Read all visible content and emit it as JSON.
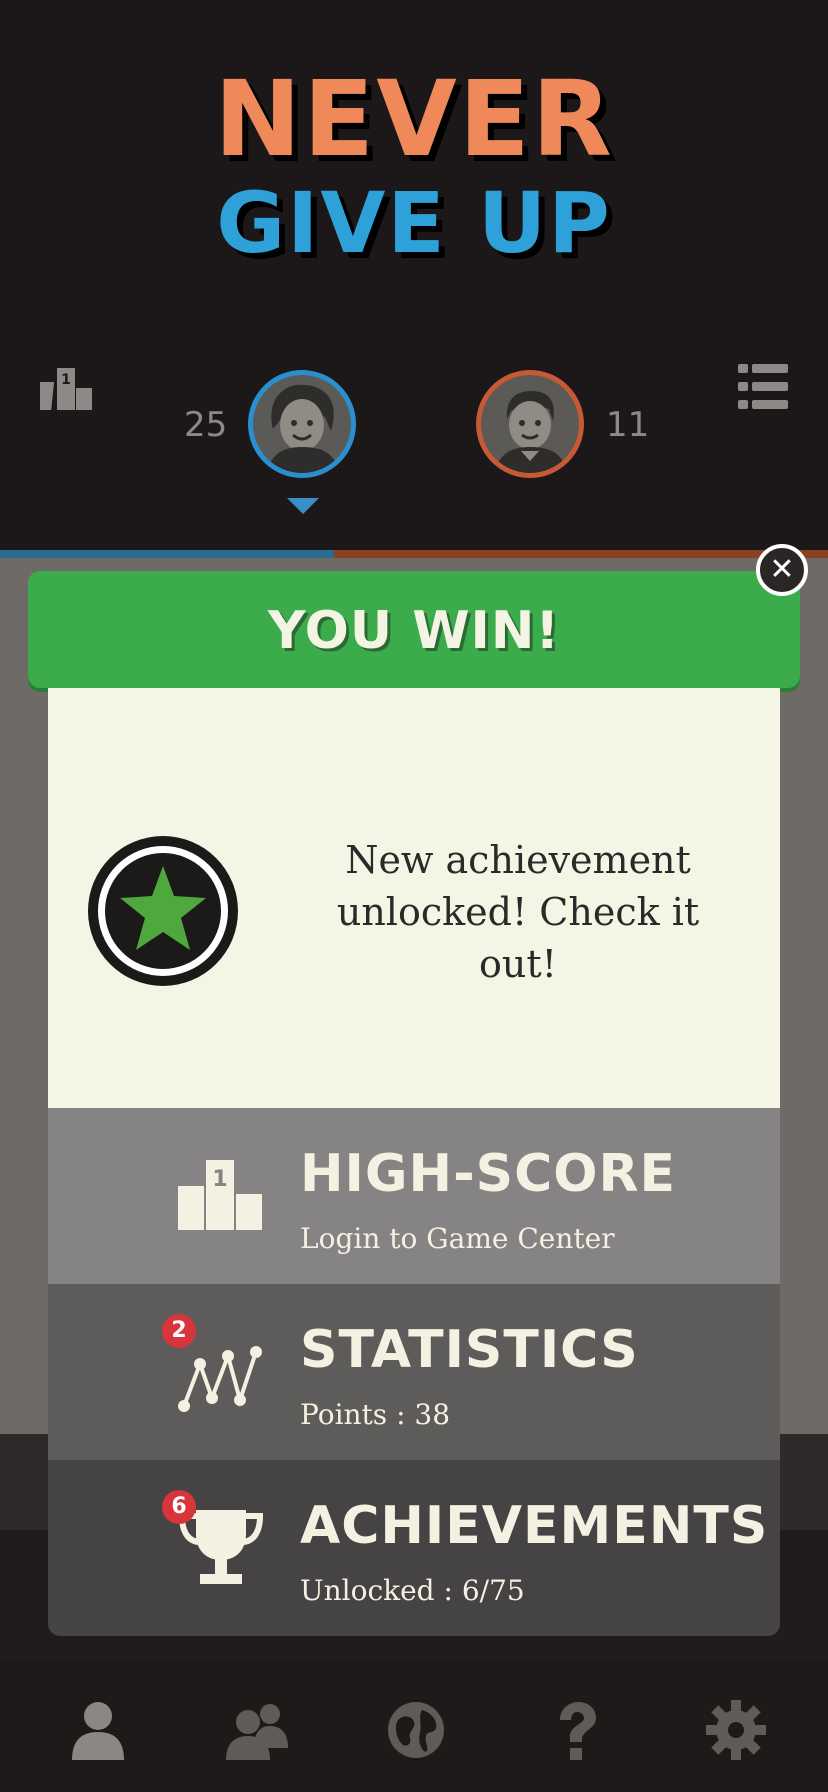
{
  "header": {
    "title_line1": "NEVER",
    "title_line2": "GIVE UP"
  },
  "scoreboard": {
    "left_score": "25",
    "right_score": "11",
    "left_player_color": "#2a8ecf",
    "right_player_color": "#c65a34",
    "icons": {
      "left": "podium-icon",
      "right": "menu-icon"
    }
  },
  "dialog": {
    "banner": "YOU WIN!",
    "close_icon": "close-icon",
    "achievement_message": "New achievement unlocked! Check it out!",
    "achievement_icon": "star-icon"
  },
  "rows": {
    "highscore": {
      "label": "HIGH-SCORE",
      "sub": "Login to Game Center",
      "icon": "podium-icon"
    },
    "statistics": {
      "label": "STATISTICS",
      "sub": "Points : 38",
      "badge": "2",
      "icon": "chart-icon"
    },
    "achievements": {
      "label": "ACHIEVEMENTS",
      "sub": "Unlocked : 6/75",
      "badge": "6",
      "icon": "trophy-icon"
    }
  },
  "tabbar": [
    "person-icon",
    "people-icon",
    "globe-icon",
    "question-icon",
    "gear-icon"
  ],
  "colors": {
    "win_green": "#3bab4b",
    "panel_bg": "#f5f5e5",
    "badge_red": "#d8343c"
  }
}
